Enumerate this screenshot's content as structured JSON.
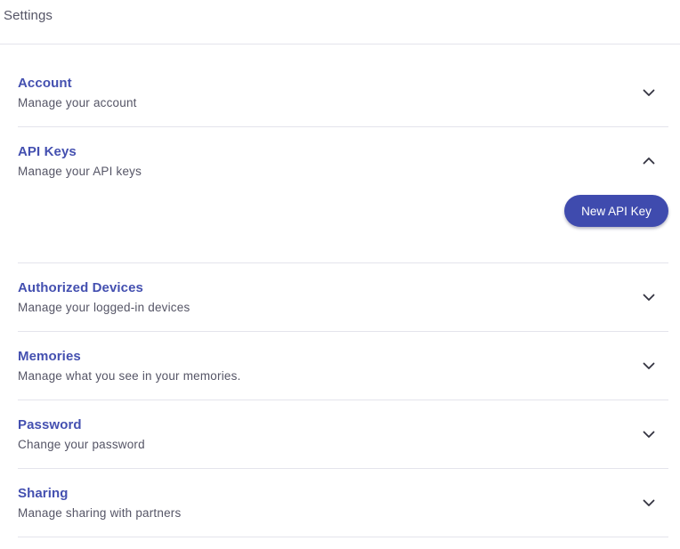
{
  "header": {
    "title": "Settings"
  },
  "sections": [
    {
      "title": "Account",
      "description": "Manage your account",
      "expanded": false,
      "icon": "chevron-down-icon"
    },
    {
      "title": "API Keys",
      "description": "Manage your API keys",
      "expanded": true,
      "icon": "chevron-up-icon",
      "action_label": "New API Key"
    },
    {
      "title": "Authorized Devices",
      "description": "Manage your logged-in devices",
      "expanded": false,
      "icon": "chevron-down-icon"
    },
    {
      "title": "Memories",
      "description": "Manage what you see in your memories.",
      "expanded": false,
      "icon": "chevron-down-icon"
    },
    {
      "title": "Password",
      "description": "Change your password",
      "expanded": false,
      "icon": "chevron-down-icon"
    },
    {
      "title": "Sharing",
      "description": "Manage sharing with partners",
      "expanded": false,
      "icon": "chevron-down-icon"
    }
  ],
  "colors": {
    "accent": "#3f4bae",
    "title": "#4450b0",
    "muted_text": "#555566",
    "divider": "#e4e4ec"
  }
}
